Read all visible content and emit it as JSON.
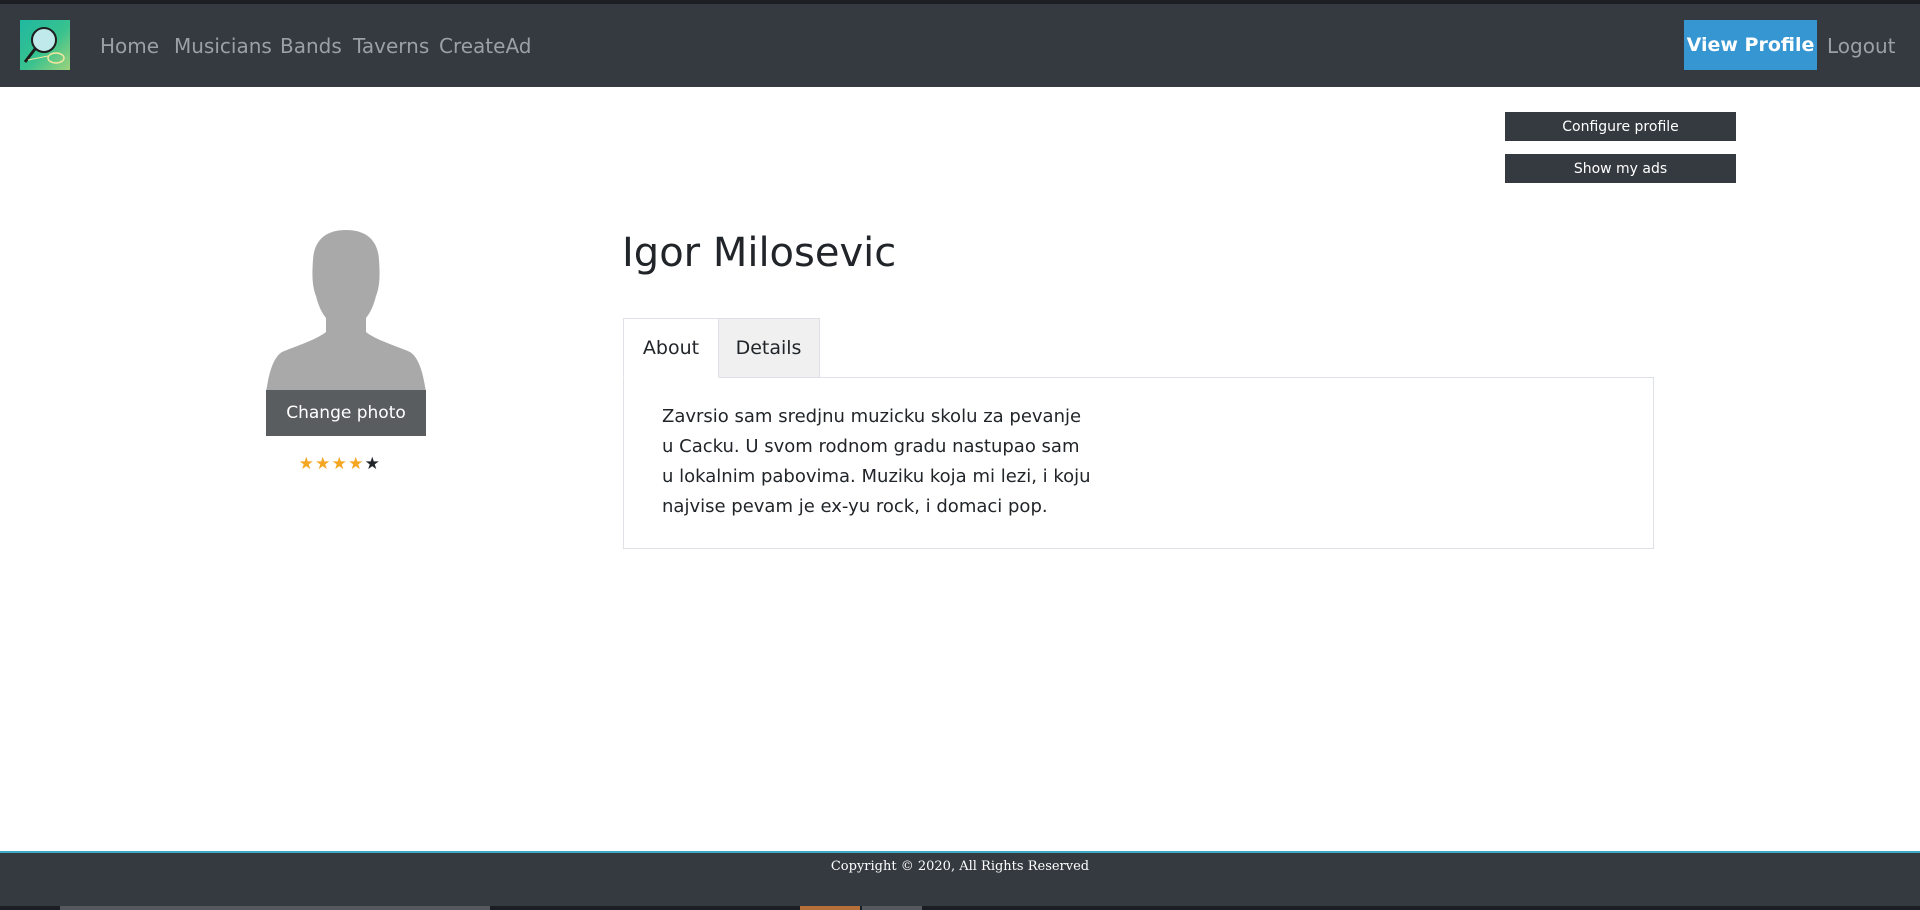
{
  "navbar": {
    "logo_icon": "magnifier-racket-logo-icon",
    "links": [
      "Home",
      "Musicians",
      "Bands",
      "Taverns",
      "CreateAd"
    ],
    "view_profile_label": "View Profile",
    "logout_label": "Logout",
    "background": "#343a40",
    "accent": "#3596d2"
  },
  "actions": {
    "configure_label": "Configure profile",
    "show_ads_label": "Show my ads"
  },
  "profile": {
    "avatar_icon": "user-silhouette-icon",
    "change_photo_label": "Change photo",
    "rating": {
      "value": 4,
      "max": 5,
      "filled_color": "#f5a623"
    },
    "name": "Igor Milosevic"
  },
  "tabs": {
    "items": [
      "About",
      "Details"
    ],
    "active": "About",
    "about_text": "Zavrsio sam sredjnu muzicku skolu za pevanje u Cacku. U svom rodnom gradu nastupao sam u lokalnim pabovima. Muziku koja mi lezi, i koju najvise pevam je ex-yu rock, i domaci pop."
  },
  "footer": {
    "copyright": "Copyright © 2020, All Rights Reserved"
  }
}
